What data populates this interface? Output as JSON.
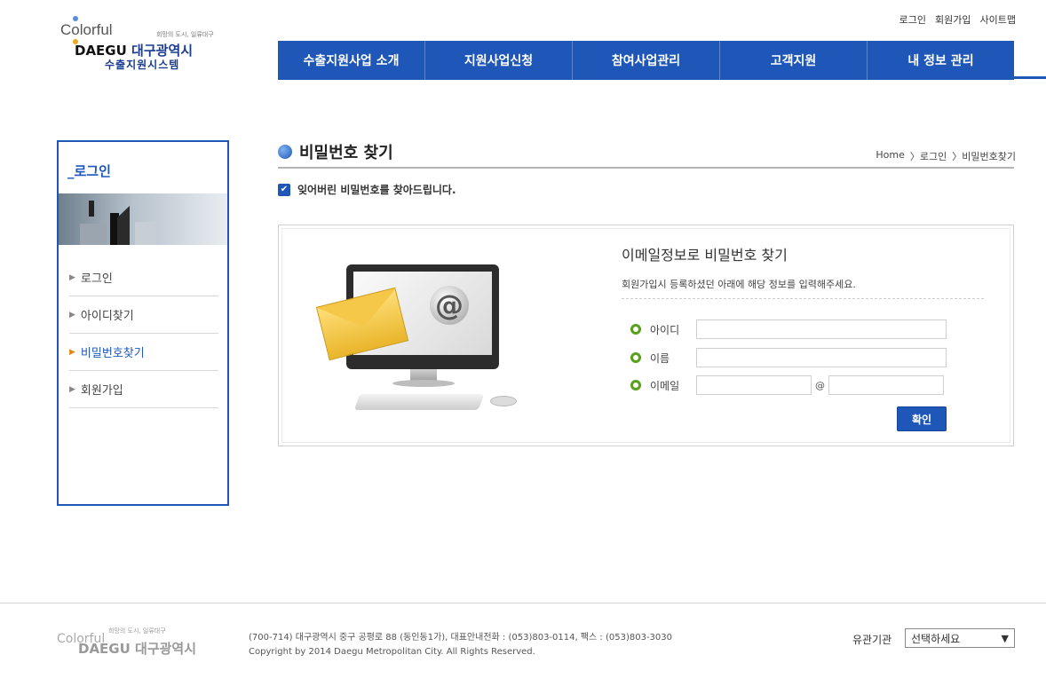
{
  "header": {
    "logo_colorful": "Colorful",
    "logo_slogan": "희망의 도시, 일류대구",
    "logo_daegu_en": "DAEGU",
    "logo_daegu_kr": "대구광역시",
    "logo_system": "수출지원시스템",
    "top_links": [
      "로그인",
      "회원가입",
      "사이트맵"
    ],
    "nav": [
      "수출지원사업 소개",
      "지원사업신청",
      "참여사업관리",
      "고객지원",
      "내 정보 관리"
    ]
  },
  "sidebar": {
    "title": "_로그인",
    "items": [
      {
        "label": "로그인"
      },
      {
        "label": "아이디찾기"
      },
      {
        "label": "비밀번호찾기"
      },
      {
        "label": "회원가입"
      }
    ]
  },
  "main": {
    "title": "비밀번호 찾기",
    "breadcrumb": [
      "Home",
      "〉로그인",
      "〉비밀번호찾기"
    ],
    "notice": "잊어버린 비밀번호를 찾아드립니다.",
    "form_title": "이메일정보로 비밀번호 찾기",
    "form_desc": "회원가입시 등록하셨던 아래에 해당 정보를 입력해주세요.",
    "fields": {
      "id_label": "아이디",
      "name_label": "이름",
      "email_label": "이메일",
      "at": "@"
    },
    "confirm_label": "확인"
  },
  "footer": {
    "logo_slogan": "희망의 도시, 일류대구",
    "logo_colorful": "Colorful",
    "logo_daegu": "DAEGU 대구광역시",
    "address": "(700-714) 대구광역시 중구 공평로 88 (동인동1가), 대표안내전화 : (053)803-0114, 팩스 : (053)803-3030",
    "copyright": "Copyright by 2014 Daegu Metropolitan City. All Rights Reserved.",
    "related_label": "유관기관",
    "related_select": "선택하세요"
  },
  "colors": {
    "brand": "#1e57b8",
    "accent_green": "#5aa01c",
    "colorbar": [
      "#f0a81c",
      "#e070b0",
      "#111111",
      "#6ab04c",
      "#5a8fd6"
    ]
  }
}
